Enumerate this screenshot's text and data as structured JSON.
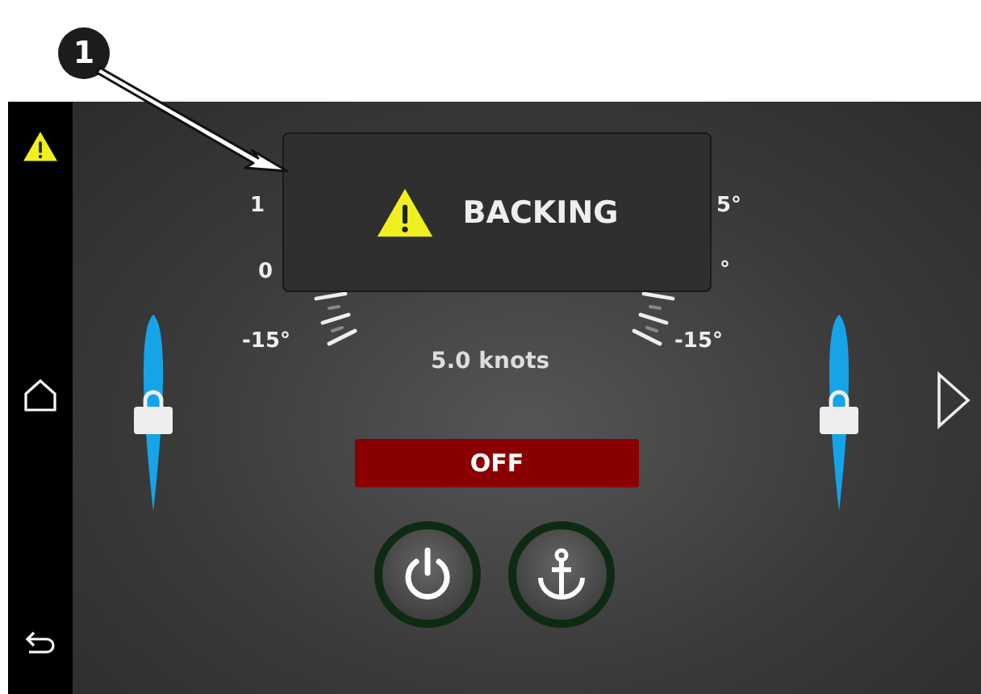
{
  "callout": {
    "number": "1"
  },
  "sidebar": {
    "items": [
      {
        "kind": "warning"
      },
      {
        "kind": "home"
      },
      {
        "kind": "back"
      }
    ]
  },
  "gauge": {
    "left_labels": [
      "1",
      "0",
      "-15°"
    ],
    "right_labels": [
      "5°",
      "°",
      "-15°"
    ],
    "speed": "5.0 knots"
  },
  "alert": {
    "title": "BACKING"
  },
  "status": {
    "label": "OFF"
  },
  "controls": [
    {
      "kind": "power"
    },
    {
      "kind": "anchor"
    }
  ]
}
